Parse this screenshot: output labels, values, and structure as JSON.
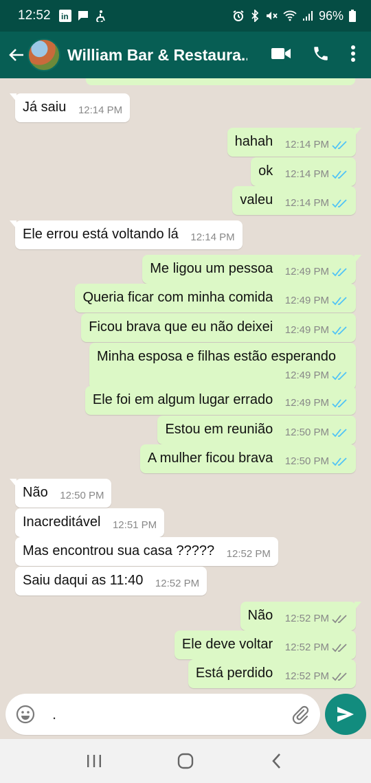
{
  "status": {
    "time": "12:52",
    "battery": "96%"
  },
  "header": {
    "contact_name": "William Bar & Restaura..."
  },
  "messages": [
    {
      "dir": "in",
      "text": "Já saiu",
      "time": "12:14 PM"
    },
    {
      "dir": "out",
      "text": "hahah",
      "time": "12:14 PM",
      "status": "read"
    },
    {
      "dir": "out",
      "text": "ok",
      "time": "12:14 PM",
      "status": "read"
    },
    {
      "dir": "out",
      "text": "valeu",
      "time": "12:14 PM",
      "status": "read"
    },
    {
      "dir": "in",
      "text": "Ele errou está voltando lá",
      "time": "12:14 PM"
    },
    {
      "dir": "out",
      "text": "Me ligou um pessoa",
      "time": "12:49 PM",
      "status": "read"
    },
    {
      "dir": "out",
      "text": "Queria ficar com minha comida",
      "time": "12:49 PM",
      "status": "read"
    },
    {
      "dir": "out",
      "text": "Ficou brava que eu não deixei",
      "time": "12:49 PM",
      "status": "read"
    },
    {
      "dir": "out",
      "text": "Minha esposa e filhas estão esperando",
      "time": "12:49 PM",
      "status": "read"
    },
    {
      "dir": "out",
      "text": "Ele foi em algum lugar errado",
      "time": "12:49 PM",
      "status": "read"
    },
    {
      "dir": "out",
      "text": "Estou em reunião",
      "time": "12:50 PM",
      "status": "read"
    },
    {
      "dir": "out",
      "text": "A mulher ficou brava",
      "time": "12:50 PM",
      "status": "read"
    },
    {
      "dir": "in",
      "text": "Não",
      "time": "12:50 PM"
    },
    {
      "dir": "in",
      "text": "Inacreditável",
      "time": "12:51 PM"
    },
    {
      "dir": "in",
      "text": "Mas encontrou sua casa ?????",
      "time": "12:52 PM"
    },
    {
      "dir": "in",
      "text": "Saiu daqui as 11:40",
      "time": "12:52 PM"
    },
    {
      "dir": "out",
      "text": "Não",
      "time": "12:52 PM",
      "status": "delivered"
    },
    {
      "dir": "out",
      "text": "Ele deve voltar",
      "time": "12:52 PM",
      "status": "delivered"
    },
    {
      "dir": "out",
      "text": "Está perdido",
      "time": "12:52 PM",
      "status": "delivered"
    }
  ],
  "composer": {
    "text": "."
  },
  "colors": {
    "header": "#075e54",
    "statusbar": "#054d44",
    "outgoing": "#dcf8c6",
    "incoming": "#ffffff",
    "chat_bg": "#e5ddd5",
    "read_tick": "#4fc3f7",
    "delivered_tick": "#8a8a8a",
    "send_button": "#128c7e"
  }
}
